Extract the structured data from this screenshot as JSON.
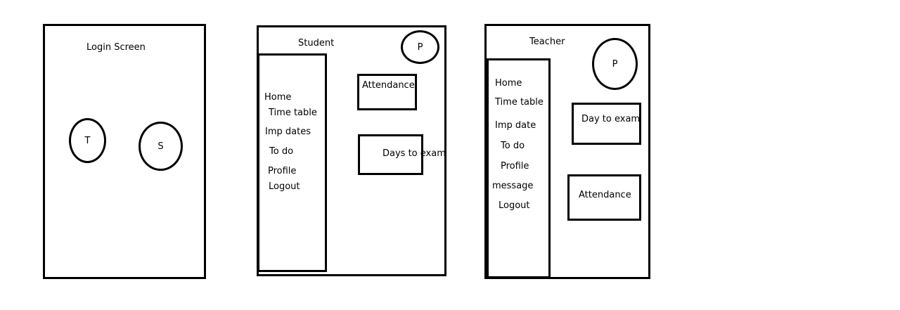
{
  "login": {
    "title": "Login Screen",
    "teacher_button": "T",
    "student_button": "S"
  },
  "student": {
    "title": "Student",
    "profile_button": "P",
    "menu": [
      "Home",
      "Time table",
      "Imp dates",
      "To do",
      "Profile",
      "Logout"
    ],
    "attendance_label": "Attendance",
    "days_to_exam_label": "Days to exam"
  },
  "teacher": {
    "title": "Teacher",
    "profile_button": "P",
    "menu": [
      "Home",
      "Time table",
      "Imp date",
      "To do",
      "Profile",
      "message",
      "Logout"
    ],
    "day_to_exam_label": "Day to exam",
    "attendance_label": "Attendance"
  }
}
